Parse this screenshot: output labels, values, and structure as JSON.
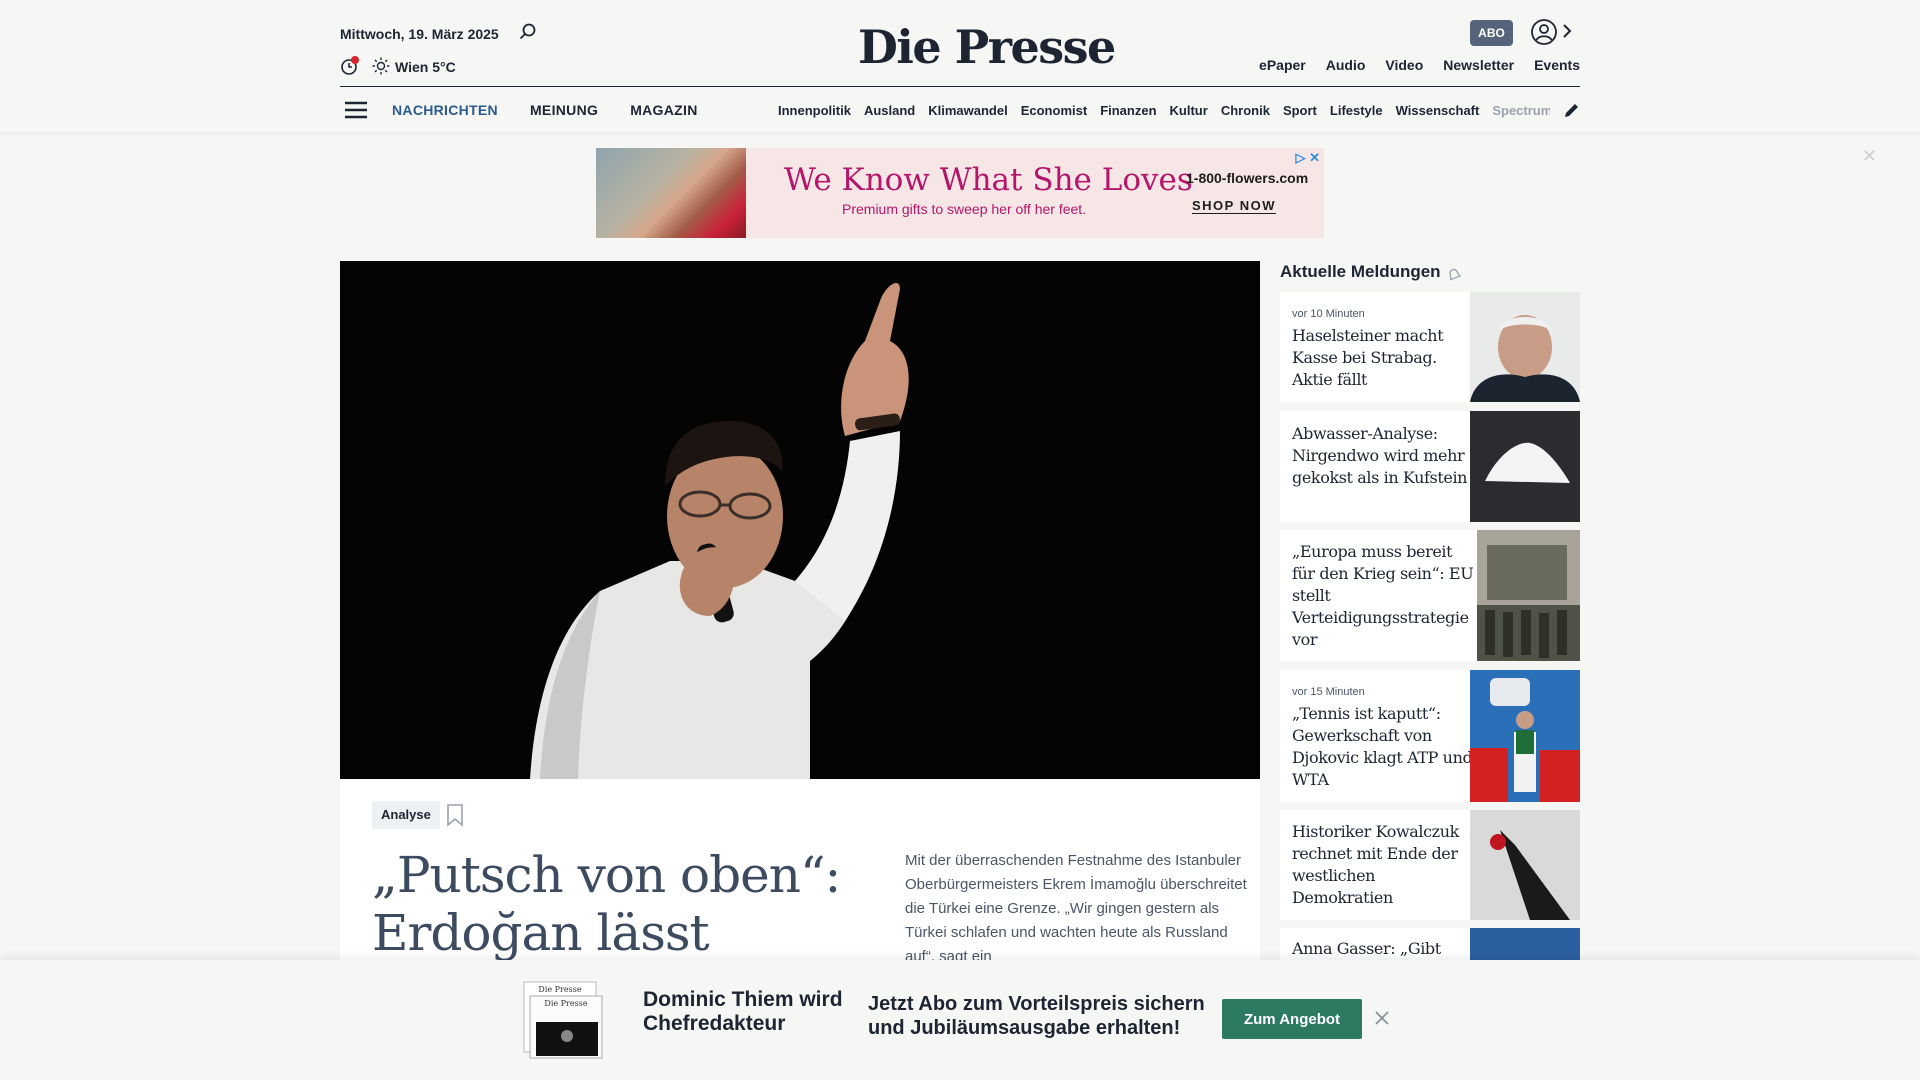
{
  "header": {
    "date": "Mittwoch, 19. März 2025",
    "weather": "Wien 5°C",
    "logo": "Die Presse",
    "abo": "ABO",
    "top_links": [
      "ePaper",
      "Audio",
      "Video",
      "Newsletter",
      "Events"
    ],
    "main_nav": [
      {
        "label": "NACHRICHTEN",
        "active": true
      },
      {
        "label": "MEINUNG"
      },
      {
        "label": "MAGAZIN"
      }
    ],
    "sub_nav": [
      "Innenpolitik",
      "Ausland",
      "Klimawandel",
      "Economist",
      "Finanzen",
      "Kultur",
      "Chronik",
      "Sport",
      "Lifestyle",
      "Wissenschaft",
      "Spectrum"
    ]
  },
  "ad": {
    "title": "We Know What She Loves",
    "subtitle": "Premium gifts to sweep her off her feet.",
    "brand": "1-800-flowers.com",
    "cta": "SHOP NOW",
    "adchoices": "▷ ✕",
    "close": "✕"
  },
  "hero": {
    "tag": "Analyse",
    "headline": "„Putsch von oben“: Erdoğan lässt",
    "lead": "Mit der überraschenden Festnahme des Istanbuler Oberbürgermeisters Ekrem İmamoğlu überschreitet die Türkei eine Grenze. „Wir gingen gestern als Türkei schlafen und wachten heute als Russland auf“, sagt ein"
  },
  "sidebar": {
    "title": "Aktuelle Meldungen",
    "items": [
      {
        "time": "vor 10 Minuten",
        "title": "Haselsteiner macht Kasse bei Strabag. Aktie fällt"
      },
      {
        "time": "",
        "title": "Abwasser-Analyse: Nirgendwo wird mehr gekokst als in Kufstein"
      },
      {
        "time": "",
        "title": "„Europa muss bereit für den Krieg sein“: EU stellt Verteidigungsstrategie vor"
      },
      {
        "time": "vor 15 Minuten",
        "title": "„Tennis ist kaputt“: Gewerkschaft von Djokovic klagt ATP und WTA"
      },
      {
        "time": "",
        "title": "Historiker Kowalczuk rechnet mit Ende der westlichen Demokratien"
      },
      {
        "time": "",
        "title": "Anna Gasser: „Gibt"
      }
    ]
  },
  "banner": {
    "name": "Dominic Thiem wird Chefredakteur",
    "message": "Jetzt Abo zum Vorteilspreis sichern und Jubiläumsausgabe erhalten!",
    "cta": "Zum Angebot"
  },
  "colors": {
    "accent_nav": "#2b5b8c",
    "cta_green": "#2d7a63",
    "abo_badge": "#55647a",
    "ad_pink": "#b3166b"
  }
}
